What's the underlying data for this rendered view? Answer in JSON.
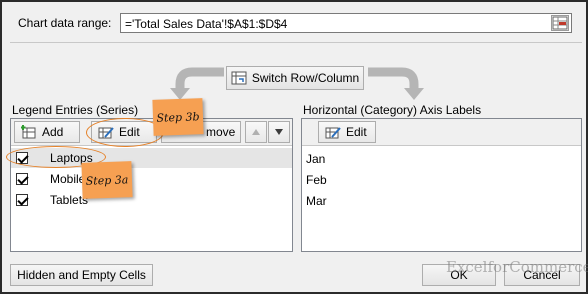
{
  "chart_range": {
    "label": "Chart data range:",
    "value": "='Total Sales Data'!$A$1:$D$4"
  },
  "switch_button": {
    "label": "Switch Row/Column"
  },
  "legend": {
    "heading": "Legend Entries (Series)",
    "add_label": "Add",
    "edit_label": "Edit",
    "remove_label": "move",
    "series": [
      {
        "name": "Laptops",
        "checked": true
      },
      {
        "name": "Mobile",
        "checked": true
      },
      {
        "name": "Tablets",
        "checked": true
      }
    ]
  },
  "category": {
    "heading": "Horizontal (Category) Axis Labels",
    "edit_label": "Edit",
    "items": [
      "Jan",
      "Feb",
      "Mar"
    ]
  },
  "footer": {
    "hidden_cells_label": "Hidden and Empty Cells",
    "ok_label": "OK",
    "cancel_label": "Cancel"
  },
  "annotations": {
    "step_3b": "Step 3b",
    "step_3a": "Step 3a"
  },
  "watermark": "ExcelforCommerce",
  "colors": {
    "sticky": "#f6a052",
    "ring": "#e5822a",
    "selection": "#e5e5e5"
  }
}
